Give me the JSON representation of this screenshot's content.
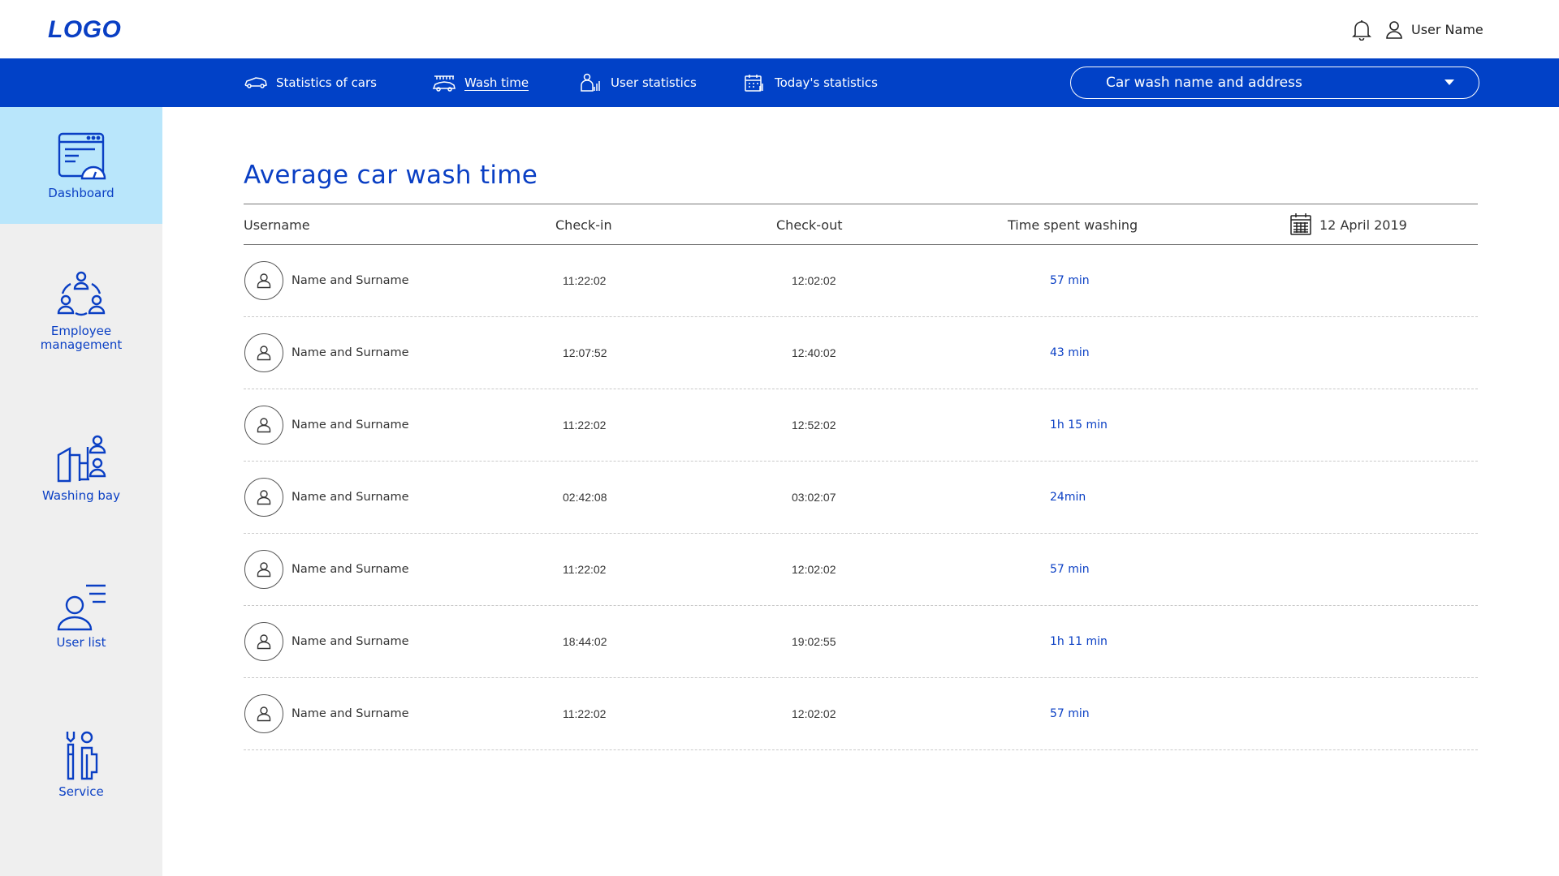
{
  "header": {
    "logo": "LOGO",
    "user_name": "User Name",
    "icons": [
      "bell-icon",
      "user-icon"
    ]
  },
  "topnav": {
    "items": [
      {
        "label": "Statistics of cars",
        "icon": "car-icon",
        "active": false
      },
      {
        "label": "Wash time",
        "icon": "car-wash-icon",
        "active": true
      },
      {
        "label": "User statistics",
        "icon": "user-stats-icon",
        "active": false
      },
      {
        "label": "Today's statistics",
        "icon": "calendar-stats-icon",
        "active": false
      }
    ],
    "carwash_select": "Car wash name and address"
  },
  "sidebar": {
    "items": [
      {
        "label": "Dashboard",
        "icon": "dashboard-icon",
        "active": true
      },
      {
        "label": "Employee management",
        "label_line1": "Employee",
        "label_line2": "management",
        "icon": "team-icon",
        "active": false
      },
      {
        "label": "Washing bay",
        "icon": "washing-bay-icon",
        "active": false
      },
      {
        "label": "User list",
        "icon": "user-list-icon",
        "active": false
      },
      {
        "label": "Service",
        "icon": "service-tools-icon",
        "active": false
      }
    ]
  },
  "main": {
    "title": "Average car wash time",
    "columns": {
      "username": "Username",
      "checkin": "Check-in",
      "checkout": "Check-out",
      "time_spent": "Time spent washing",
      "date": "12 April 2019"
    },
    "rows": [
      {
        "name": "Name and Surname",
        "checkin": "11:22:02",
        "checkout": "12:02:02",
        "duration": "57 min"
      },
      {
        "name": "Name and Surname",
        "checkin": "12:07:52",
        "checkout": "12:40:02",
        "duration": "43 min"
      },
      {
        "name": "Name and Surname",
        "checkin": "11:22:02",
        "checkout": "12:52:02",
        "duration": "1h 15 min"
      },
      {
        "name": "Name and Surname",
        "checkin": "02:42:08",
        "checkout": "03:02:07",
        "duration": "24min"
      },
      {
        "name": "Name and Surname",
        "checkin": "11:22:02",
        "checkout": "12:02:02",
        "duration": "57 min"
      },
      {
        "name": "Name and Surname",
        "checkin": "18:44:02",
        "checkout": "19:02:55",
        "duration": "1h 11 min"
      },
      {
        "name": "Name and Surname",
        "checkin": "11:22:02",
        "checkout": "12:02:02",
        "duration": "57 min"
      }
    ]
  },
  "colors": {
    "brand_blue": "#0141c7",
    "accent_text": "#0a3fc4",
    "sidebar_bg": "#efefef",
    "sidebar_active": "#b9e6fb"
  }
}
